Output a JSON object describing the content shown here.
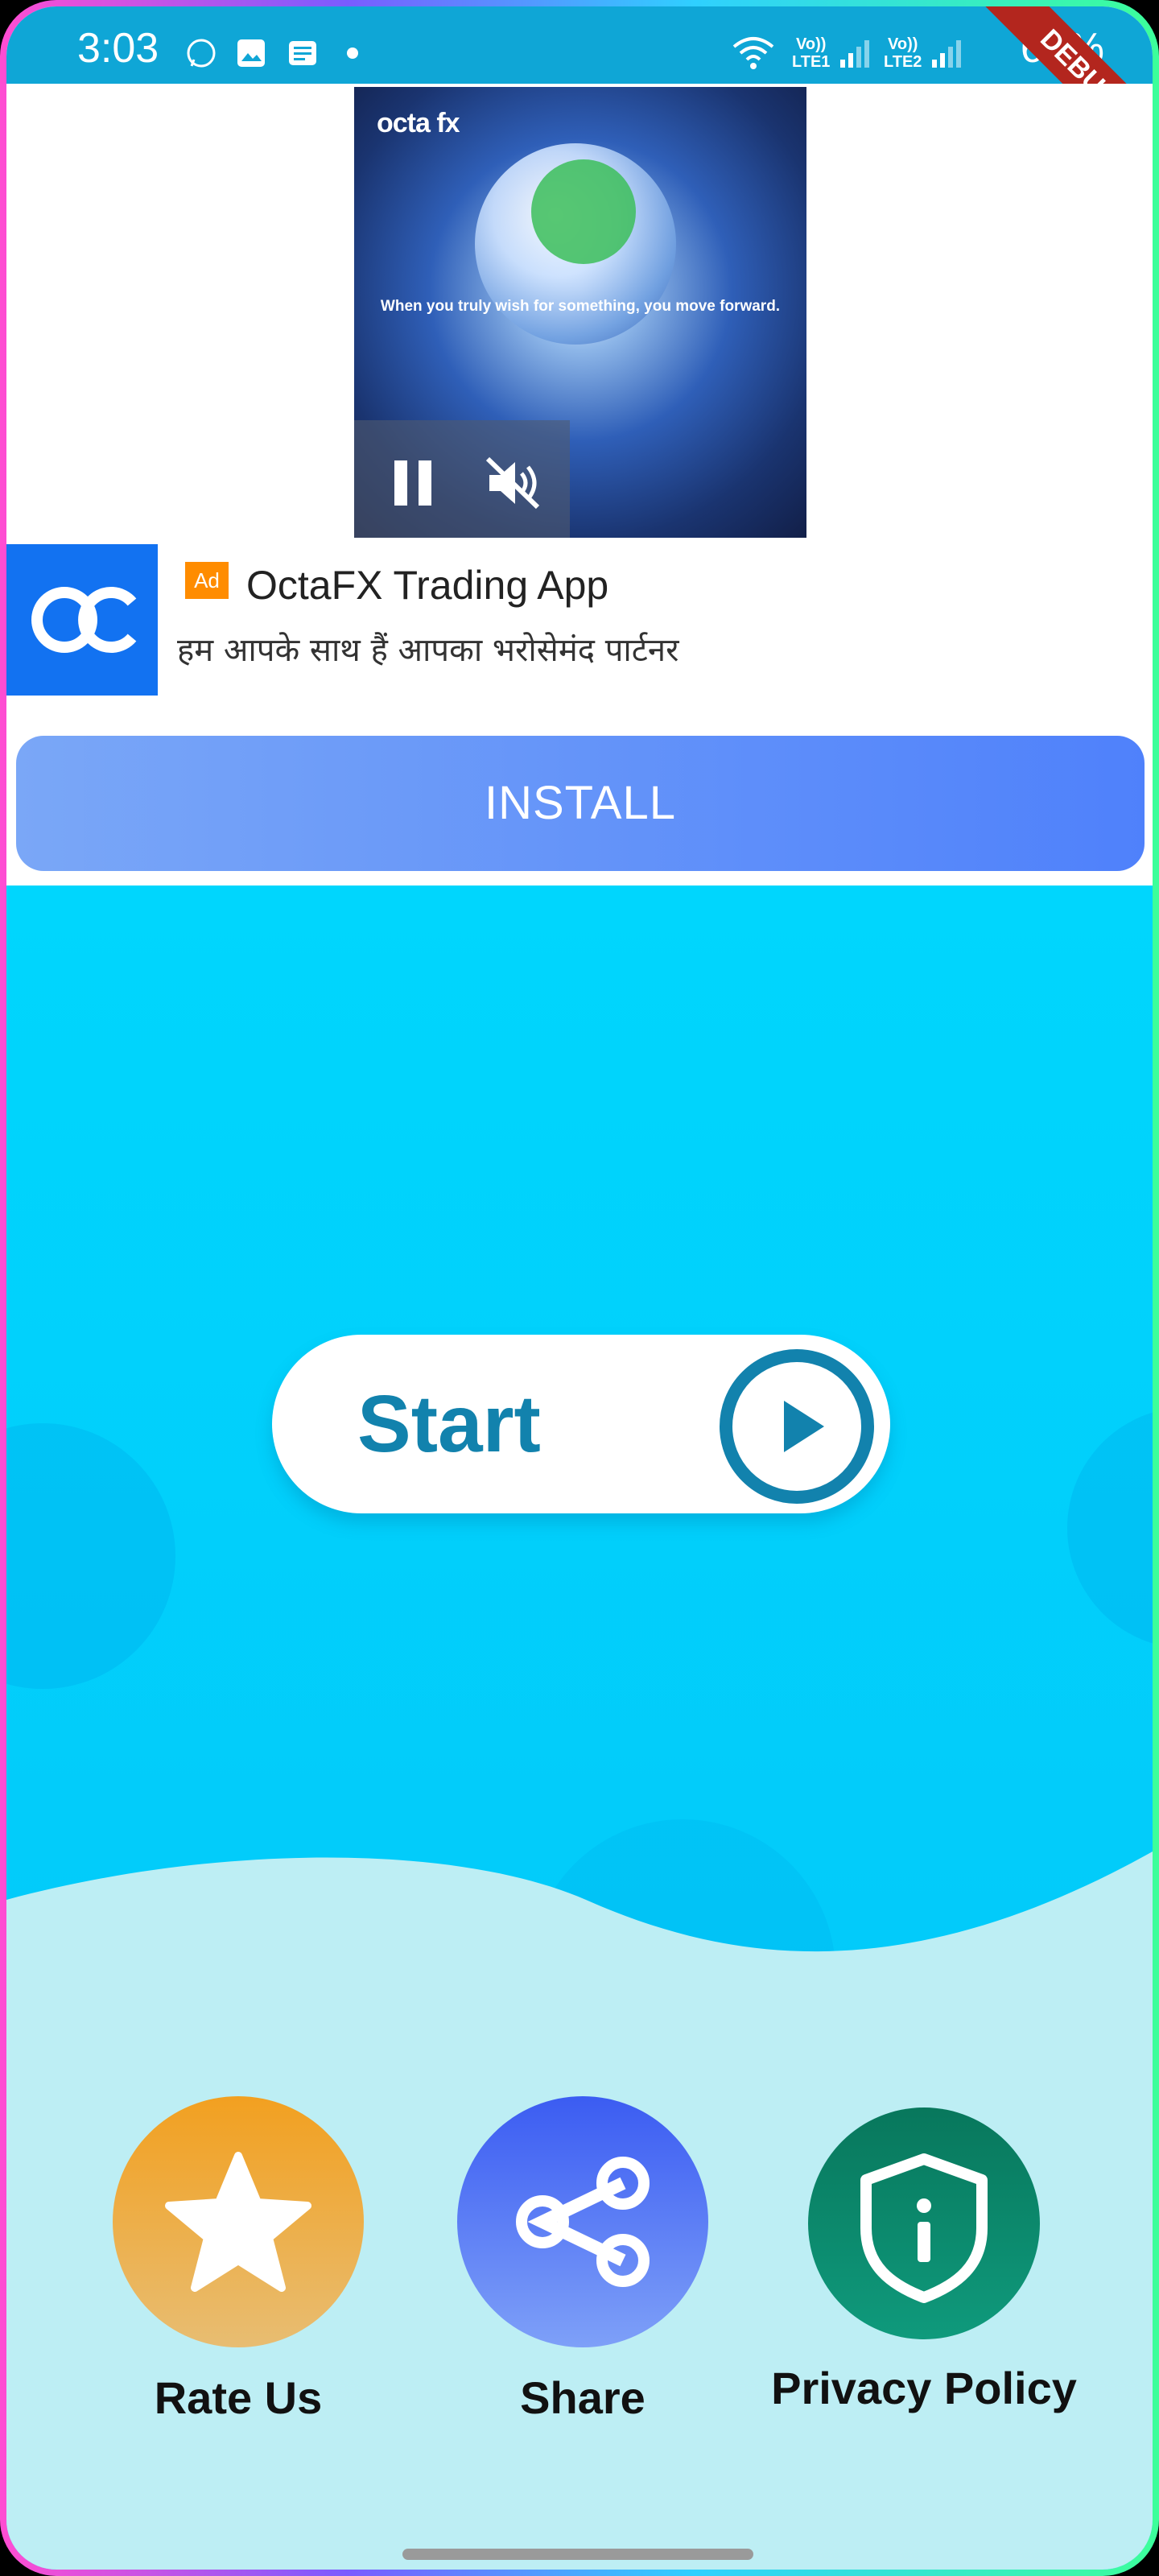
{
  "status_bar": {
    "time": "3:03",
    "sim1_label": "Vo))",
    "sim1_type": "LTE1",
    "sim2_label": "Vo))",
    "sim2_type": "LTE2",
    "battery": "67%",
    "debug_banner": "DEBUG"
  },
  "ad": {
    "video_brand": "octa fx",
    "video_caption": "When you truly wish for something, you move forward.",
    "badge": "Ad",
    "title": "OctaFX Trading App",
    "description": "हम आपके साथ हैं आपका भरोसेमंद पार्टनर",
    "install_label": "INSTALL"
  },
  "main": {
    "start_label": "Start",
    "actions": {
      "rate": "Rate Us",
      "share": "Share",
      "privacy": "Privacy Policy"
    }
  },
  "colors": {
    "main_background": "#00d6fd",
    "wave_background": "#bdeef4",
    "start_accent": "#1282ad",
    "rate": "#f0a437",
    "share": "#4b6ef5",
    "privacy": "#0b8a6a",
    "install": "#5b8cfb"
  }
}
